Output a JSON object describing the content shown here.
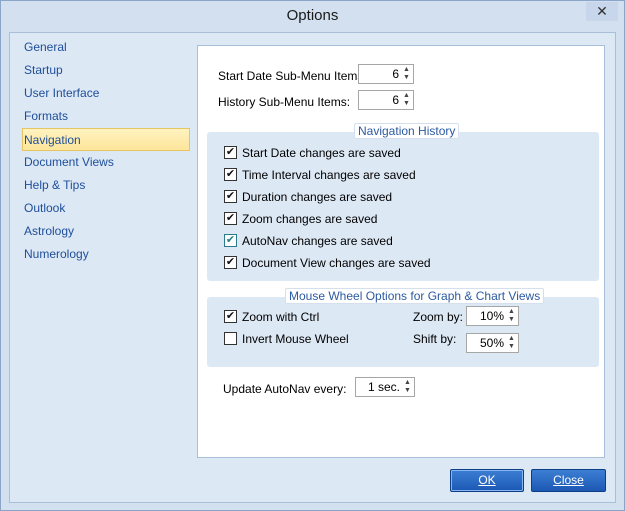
{
  "window": {
    "title": "Options",
    "close_glyph": "✕"
  },
  "sidebar": {
    "items": [
      {
        "label": "General"
      },
      {
        "label": "Startup"
      },
      {
        "label": "User Interface"
      },
      {
        "label": "Formats"
      },
      {
        "label": "Navigation",
        "selected": true
      },
      {
        "label": "Document Views"
      },
      {
        "label": "Help & Tips"
      },
      {
        "label": "Outlook"
      },
      {
        "label": "Astrology"
      },
      {
        "label": "Numerology"
      }
    ]
  },
  "panel": {
    "start_date": {
      "label": "Start Date Sub-Menu Items:",
      "value": "6"
    },
    "history": {
      "label": "History Sub-Menu Items:",
      "value": "6"
    },
    "nav_history": {
      "title": "Navigation History",
      "items": [
        {
          "label": "Start Date changes are saved",
          "checked": true
        },
        {
          "label": "Time Interval changes are saved",
          "checked": true
        },
        {
          "label": "Duration changes are saved",
          "checked": true
        },
        {
          "label": "Zoom changes are saved",
          "checked": true
        },
        {
          "label": "AutoNav changes are saved",
          "checked": true
        },
        {
          "label": "Document View changes are saved",
          "checked": true
        }
      ]
    },
    "mouse_wheel": {
      "title": "Mouse Wheel Options for Graph & Chart Views",
      "zoom_ctrl": {
        "label": "Zoom with Ctrl",
        "checked": true
      },
      "invert": {
        "label": "Invert Mouse Wheel",
        "checked": false
      },
      "zoom_by": {
        "label": "Zoom by:",
        "value": "10%"
      },
      "shift_by": {
        "label": "Shift by:",
        "value": "50%"
      }
    },
    "autonav": {
      "label": "Update AutoNav every:",
      "value": "1 sec."
    }
  },
  "buttons": {
    "ok": "OK",
    "close": "Close"
  },
  "glyphs": {
    "check": "✔",
    "spin_up": "▲",
    "spin_down": "▼"
  }
}
